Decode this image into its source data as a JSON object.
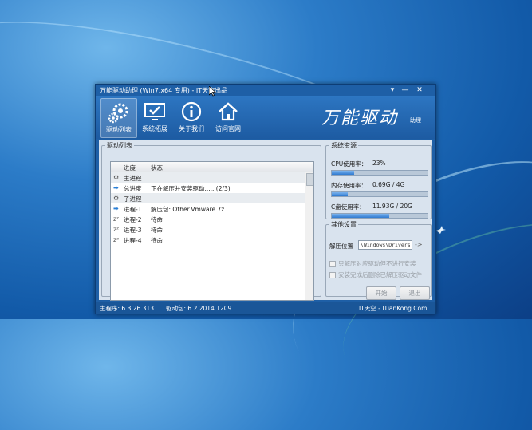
{
  "window": {
    "title": "万能驱动助理 (Win7.x64 专用) - IT天空出品",
    "controls": {
      "settings": "▾",
      "minimize": "—",
      "close": "✕"
    }
  },
  "toolbar": [
    {
      "label": "驱动列表",
      "icon": "gears-icon",
      "active": true
    },
    {
      "label": "系统拓展",
      "icon": "monitor-check-icon",
      "active": false
    },
    {
      "label": "关于我们",
      "icon": "info-icon",
      "active": false
    },
    {
      "label": "访问官网",
      "icon": "home-icon",
      "active": false
    }
  ],
  "logo": {
    "main": "万能驱动",
    "sub": "助理"
  },
  "drivers": {
    "legend": "驱动列表",
    "columns": [
      "进度",
      "状态"
    ],
    "rows": [
      {
        "icon": "gear-icon",
        "name": "主进程",
        "status": ""
      },
      {
        "icon": "arrow-icon",
        "name": "总进度",
        "status": "正在解压并安装驱动..... (2/3)"
      },
      {
        "icon": "gear-icon",
        "name": "子进程",
        "status": ""
      },
      {
        "icon": "arrow-icon",
        "name": "进程-1",
        "status": "解压包: Other.Vmware.7z"
      },
      {
        "icon": "sleep-icon",
        "name": "进程-2",
        "status": "待命"
      },
      {
        "icon": "sleep-icon",
        "name": "进程-3",
        "status": "待命"
      },
      {
        "icon": "sleep-icon",
        "name": "进程-4",
        "status": "待命"
      }
    ]
  },
  "resources": {
    "legend": "系统资源",
    "cpu": {
      "label": "CPU使用率：",
      "value": "23%",
      "fraction": 0.23
    },
    "mem": {
      "label": "内存使用率：",
      "value": "0.69G / 4G",
      "fraction": 0.17
    },
    "disk": {
      "label": "C盘使用率：",
      "value": "11.93G / 20G",
      "fraction": 0.6
    }
  },
  "other": {
    "legend": "其他设置",
    "path_label": "解压位置",
    "path_value": "\\Windows\\Drivers",
    "opt1": "只解压对应驱动但不进行安装",
    "opt2": "安装完成后删除已解压驱动文件",
    "start": "开始",
    "exit": "退出"
  },
  "status": {
    "main": "主程序: 6.3.26.313",
    "pkg": "驱动包: 6.2.2014.1209",
    "site": "IT天空 - ITianKong.Com"
  },
  "colors": {
    "window": "#1e5fa6",
    "panel": "#d9e3ee",
    "bar": "#2f7ad0"
  }
}
